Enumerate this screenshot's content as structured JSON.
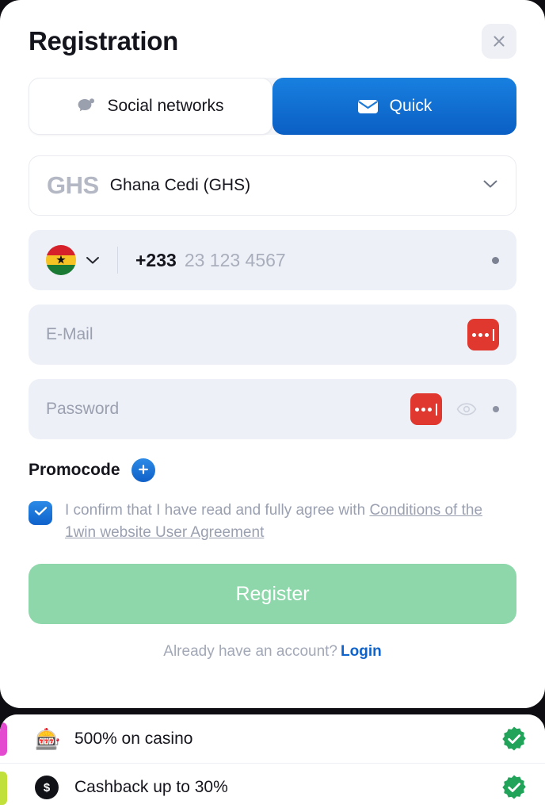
{
  "modal": {
    "title": "Registration",
    "close_icon": "close-icon"
  },
  "tabs": [
    {
      "label": "Social networks",
      "icon": "chat-bubble-icon",
      "active": false
    },
    {
      "label": "Quick",
      "icon": "envelope-icon",
      "active": true
    }
  ],
  "currency": {
    "code": "GHS",
    "name": "Ghana Cedi (GHS)",
    "chevron_icon": "chevron-down-icon"
  },
  "phone": {
    "flag": "ghana-flag-icon",
    "flag_star": "★",
    "chevron_icon": "chevron-down-icon",
    "dial_code": "+233",
    "placeholder": "23 123 4567",
    "trailing_dot_icon": "dot-icon"
  },
  "email": {
    "placeholder": "E-Mail",
    "manager_icon": "password-manager-icon"
  },
  "password": {
    "placeholder": "Password",
    "manager_icon": "password-manager-icon",
    "eye_icon": "eye-icon",
    "trailing_dot_icon": "dot-icon"
  },
  "promocode": {
    "label": "Promocode",
    "add_icon": "plus-icon"
  },
  "terms": {
    "checked": true,
    "check_icon": "check-icon",
    "text_lead": "I confirm that I have read and fully agree with ",
    "link_text": "Conditions of the 1win website User Agreement"
  },
  "register": {
    "label": "Register"
  },
  "login": {
    "prompt": "Already have an account?",
    "link_label": "Login"
  },
  "bonuses": [
    {
      "label": "500% on casino",
      "icon": "slot-machine-icon",
      "emoji": "🎰",
      "accent": "#e44ad0",
      "status_icon": "verified-badge-icon"
    },
    {
      "label": "Cashback up to 30%",
      "icon": "cashback-coin-icon",
      "emoji": "",
      "accent": "#c2e03a",
      "status_icon": "verified-badge-icon"
    }
  ],
  "colors": {
    "brand_blue": "#1170d8",
    "register_green": "#8ed7aa",
    "verified_green": "#21a35a",
    "manager_red": "#e0382e",
    "background": "#0d0d12"
  }
}
